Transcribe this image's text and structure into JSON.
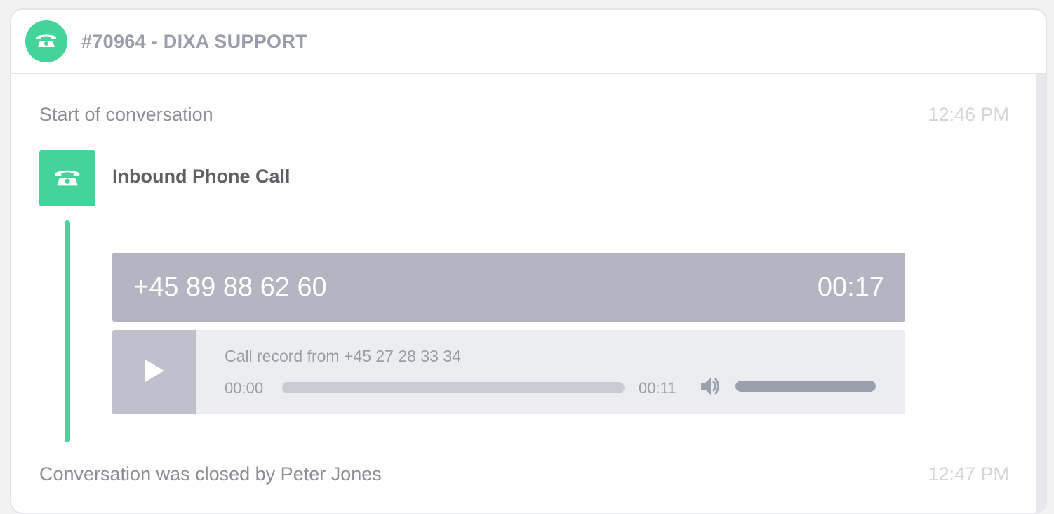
{
  "header": {
    "title": "#70964 - DIXA SUPPORT",
    "avatar_icon": "phone-icon"
  },
  "events": {
    "start": {
      "text": "Start of conversation",
      "time": "12:46 PM"
    },
    "closed": {
      "text": "Conversation was closed by Peter Jones",
      "time": "12:47 PM"
    }
  },
  "call": {
    "icon": "phone-icon",
    "title": "Inbound Phone Call",
    "phone_number": "+45 89 88 62 60",
    "duration": "00:17"
  },
  "player": {
    "play_icon": "play-icon",
    "record_label": "Call record from +45 27 28 33 34",
    "current_time": "00:00",
    "total_time": "00:11",
    "progress_fraction": 0,
    "volume_icon": "volume-icon",
    "volume_fraction": 1
  },
  "colors": {
    "accent": "#44d49a",
    "number_bar": "#b3b6c1",
    "player_bg": "#ecedf0"
  }
}
